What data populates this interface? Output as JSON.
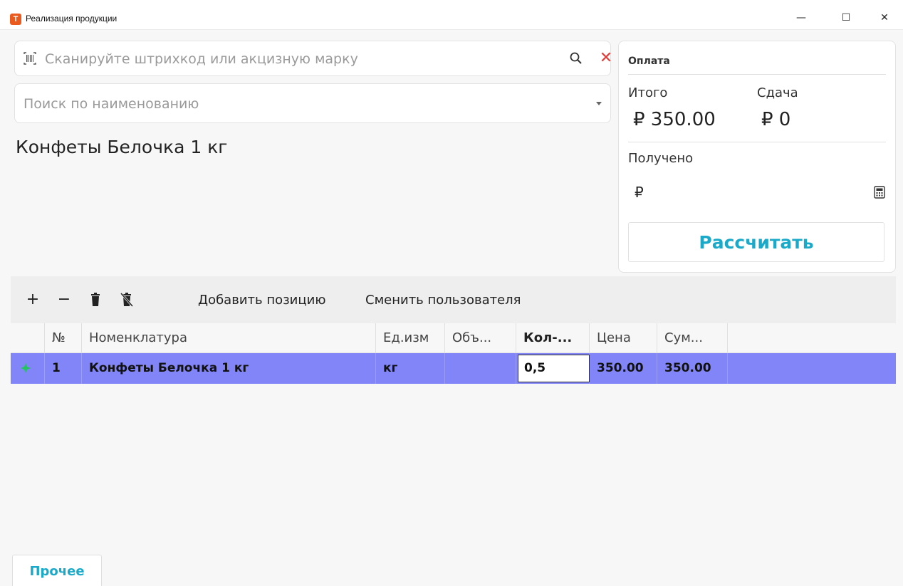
{
  "window": {
    "title": "Реализация продукции",
    "app_icon_letter": "T",
    "minimize": "—",
    "maximize": "☐",
    "close": "✕"
  },
  "scan": {
    "placeholder": "Сканируйте штрихкод или акцизную марку",
    "value": "",
    "clear_glyph": "✕"
  },
  "name_search": {
    "placeholder": "Поиск по наименованию",
    "value": ""
  },
  "product_title": "Конфеты Белочка 1 кг",
  "payment": {
    "title": "Оплата",
    "total_label": "Итого",
    "total_value": "₽ 350.00",
    "change_label": "Сдача",
    "change_value": "₽ 0",
    "received_label": "Получено",
    "received_currency": "₽",
    "calculate_label": "Рассчитать"
  },
  "toolbar": {
    "plus": "+",
    "minus": "−",
    "add_position": "Добавить позицию",
    "switch_user": "Сменить пользователя"
  },
  "table": {
    "columns": [
      "№",
      "Номенклатура",
      "Ед.изм",
      "Объ...",
      "Кол-...",
      "Цена",
      "Сум..."
    ],
    "rows": [
      {
        "num": "1",
        "name": "Конфеты Белочка 1 кг",
        "unit": "кг",
        "volume": "",
        "qty": "0,5",
        "price": "350.00",
        "sum": "350.00"
      }
    ]
  },
  "footer": {
    "other_label": "Прочее"
  },
  "colors": {
    "accent": "#1aa9c9",
    "selected_row": "#8285f7",
    "clear_red": "#e53935",
    "row_marker": "#22c55e",
    "app_icon": "#ea5a1f"
  }
}
